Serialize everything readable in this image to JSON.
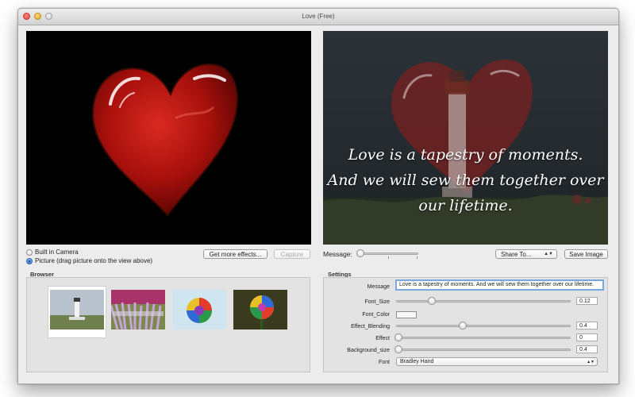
{
  "window": {
    "title": "Love (Free)"
  },
  "overlay": {
    "lines": [
      "Love is a tapestry of moments.",
      "And we will sew them together over",
      "our lifetime."
    ]
  },
  "source": {
    "options": [
      {
        "label": "Built in Camera",
        "selected": false
      },
      {
        "label": "Picture (drag picture onto the view above)",
        "selected": true
      }
    ],
    "buttons": {
      "get_more_effects": "Get more effects...",
      "capture": "Capture"
    }
  },
  "message_bar": {
    "label": "Message:",
    "slider_value": 0,
    "share_label": "Share To...",
    "save_label": "Save Image"
  },
  "browser": {
    "label": "Browser",
    "thumbnails": [
      {
        "name": "lighthouse",
        "selected": true
      },
      {
        "name": "flower-field",
        "selected": false
      },
      {
        "name": "rainbow-rose",
        "selected": false
      },
      {
        "name": "rainbow-rose-dark",
        "selected": false
      }
    ]
  },
  "settings": {
    "label": "Settings",
    "message_label": "Message",
    "message_value": "Love is a tapestry of moments. And we will sew them together over our lifetime.",
    "font_size_label": "Font_Size",
    "font_size_value": "0.12",
    "font_color_label": "Font_Color",
    "font_color_hex": "#f8f8f8",
    "effect_blending_label": "Effect_Blending",
    "effect_blending_value": "0.4",
    "effect_label": "Effect",
    "effect_value": "0",
    "background_size_label": "Background_size",
    "background_size_value": "0.4",
    "font_label": "Font",
    "font_value": "Bradley Hand"
  },
  "colors": {
    "accent": "#3d7fd8",
    "heart": "#b3120f"
  }
}
